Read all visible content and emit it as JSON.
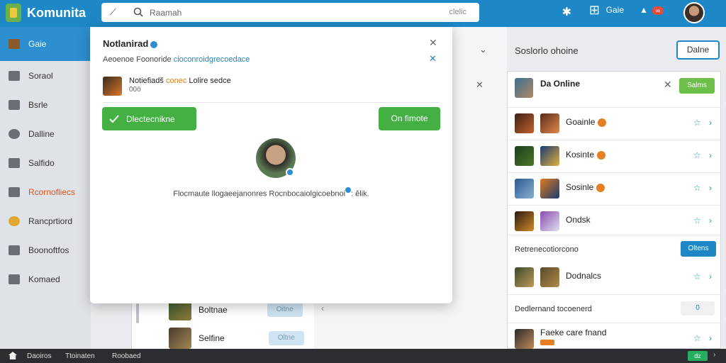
{
  "app": {
    "name": "Komunita"
  },
  "search": {
    "back_glyph": "⟋",
    "placeholder": "Raamah",
    "shortcut": "clelic"
  },
  "topbar": {
    "gear": "✱",
    "basket": "⊞",
    "tab_label": "Gaie",
    "notif": "▲",
    "notif_count": "∞"
  },
  "sidebar": {
    "items": [
      {
        "label": "Gaie",
        "icon": "chest-icon"
      },
      {
        "label": "Soraol",
        "icon": "users-icon"
      },
      {
        "label": "Bsrle",
        "icon": "pencil-icon"
      },
      {
        "label": "Dalline",
        "icon": "globe-icon"
      },
      {
        "label": "Salfido",
        "icon": "lock-icon"
      },
      {
        "label": "Rcornofliecs",
        "icon": "stack-icon"
      },
      {
        "label": "Rancprtiord",
        "icon": "coin-icon"
      },
      {
        "label": "Boonoftfos",
        "icon": "group-icon"
      },
      {
        "label": "Komaed",
        "icon": "book-icon"
      }
    ]
  },
  "middle": {
    "chevron": "⌄",
    "close": "✕",
    "list": [
      {
        "label": "Boltnae",
        "action": "Oitne"
      },
      {
        "label": "Selfine",
        "action": "Oltne"
      }
    ]
  },
  "right": {
    "title": "Soslorlo ohoine",
    "button": "Dalne",
    "head": {
      "name": "Da Online",
      "action": "Salms"
    },
    "rows": [
      {
        "label": "Goainle",
        "verified": true
      },
      {
        "label": "Kosinte",
        "verified": true
      },
      {
        "label": "Sosinle",
        "verified": true
      },
      {
        "label": "Ondsk",
        "verified": false
      }
    ],
    "section1": {
      "label": "Retrenecotiorcono",
      "button": "Oltens"
    },
    "row5": {
      "label": "Dodnalcs"
    },
    "section2": {
      "label": "Dedlernand tocoenerd",
      "toggle": "0"
    },
    "row6": {
      "label": "Faeke care fnand"
    },
    "action_icons": "☆ ›"
  },
  "modal": {
    "title": "Notlanirad",
    "subtitle": "Aeoenoe Foonoride",
    "subtitle_link": "cioconroidgrecoedace",
    "entry": {
      "name": "Notiefiadš",
      "highlight": "conec",
      "rest": "Lolire sedce",
      "meta": "00ö"
    },
    "left_button": "Dlectecnikne",
    "right_button": "On fimote",
    "caption": "Flocmaute llogaeejanonres Rocnbocaiolgicoebnoi",
    "caption_tail": ": ělik."
  },
  "bottombar": {
    "items": [
      "Daoiros",
      "Ttoinaten",
      "Roobaed"
    ],
    "pill": "dz",
    "arrow": "›"
  }
}
